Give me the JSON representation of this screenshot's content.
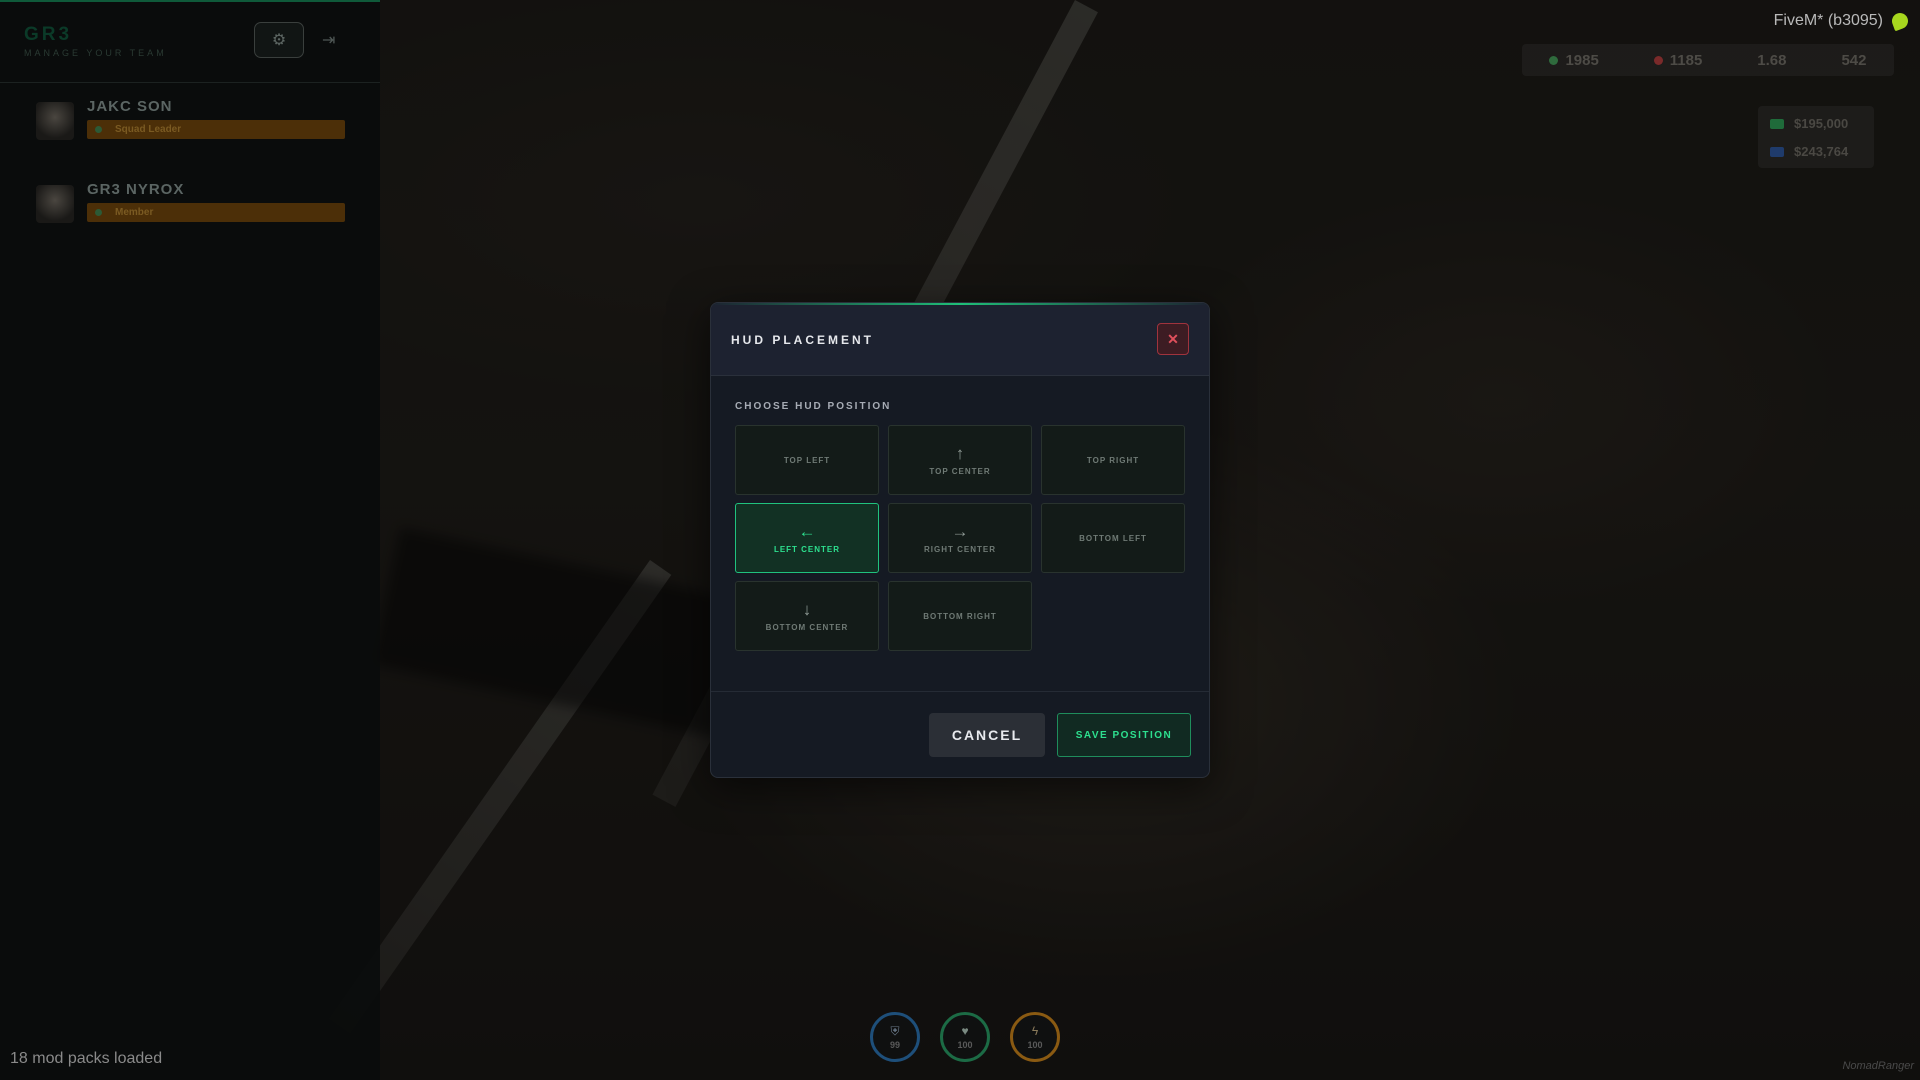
{
  "client": {
    "title": "FiveM* (b3095)",
    "icon": "fivem-leaf-icon"
  },
  "sidebar": {
    "brand": "GR3",
    "brand_subtitle": "MANAGE YOUR TEAM",
    "settings_icon": "gear-icon",
    "logout_icon": "logout-icon",
    "members": [
      {
        "name": "JAKC SON",
        "role": "Squad Leader"
      },
      {
        "name": "GR3 NYROX",
        "role": "Member"
      }
    ]
  },
  "hud_stats": {
    "values": [
      "1985",
      "1185",
      "1.68",
      "542"
    ],
    "colors": [
      "#2f6b3d",
      "#7a2a2a",
      "#4d4b46",
      "#4d4b46"
    ]
  },
  "money": {
    "cash": "$195,000",
    "bank": "$243,764",
    "cash_color": "#1f6b3a",
    "bank_color": "#1f3b6b"
  },
  "status": [
    {
      "icon": "shield-icon",
      "value": "99",
      "color": "#1e4f7a"
    },
    {
      "icon": "heart-icon",
      "value": "100",
      "color": "#1c6b45"
    },
    {
      "icon": "lightning-icon",
      "value": "100",
      "color": "#8a5a12"
    }
  ],
  "modal": {
    "title": "HUD PLACEMENT",
    "close_icon": "close-icon",
    "section_label": "CHOOSE HUD POSITION",
    "positions": [
      {
        "label": "TOP LEFT",
        "arrow": ""
      },
      {
        "label": "TOP CENTER",
        "arrow": "↑"
      },
      {
        "label": "TOP RIGHT",
        "arrow": ""
      },
      {
        "label": "LEFT CENTER",
        "arrow": "←"
      },
      {
        "label": "RIGHT CENTER",
        "arrow": "→"
      },
      {
        "label": "BOTTOM LEFT",
        "arrow": ""
      },
      {
        "label": "BOTTOM CENTER",
        "arrow": "↓"
      },
      {
        "label": "BOTTOM RIGHT",
        "arrow": ""
      }
    ],
    "selected": "LEFT CENTER",
    "accent_color": "#2de08f",
    "cancel_label": "CANCEL",
    "save_label": "SAVE POSITION"
  },
  "footer": {
    "mod_packs": "18 mod packs loaded",
    "watermark": "NomadRanger"
  }
}
